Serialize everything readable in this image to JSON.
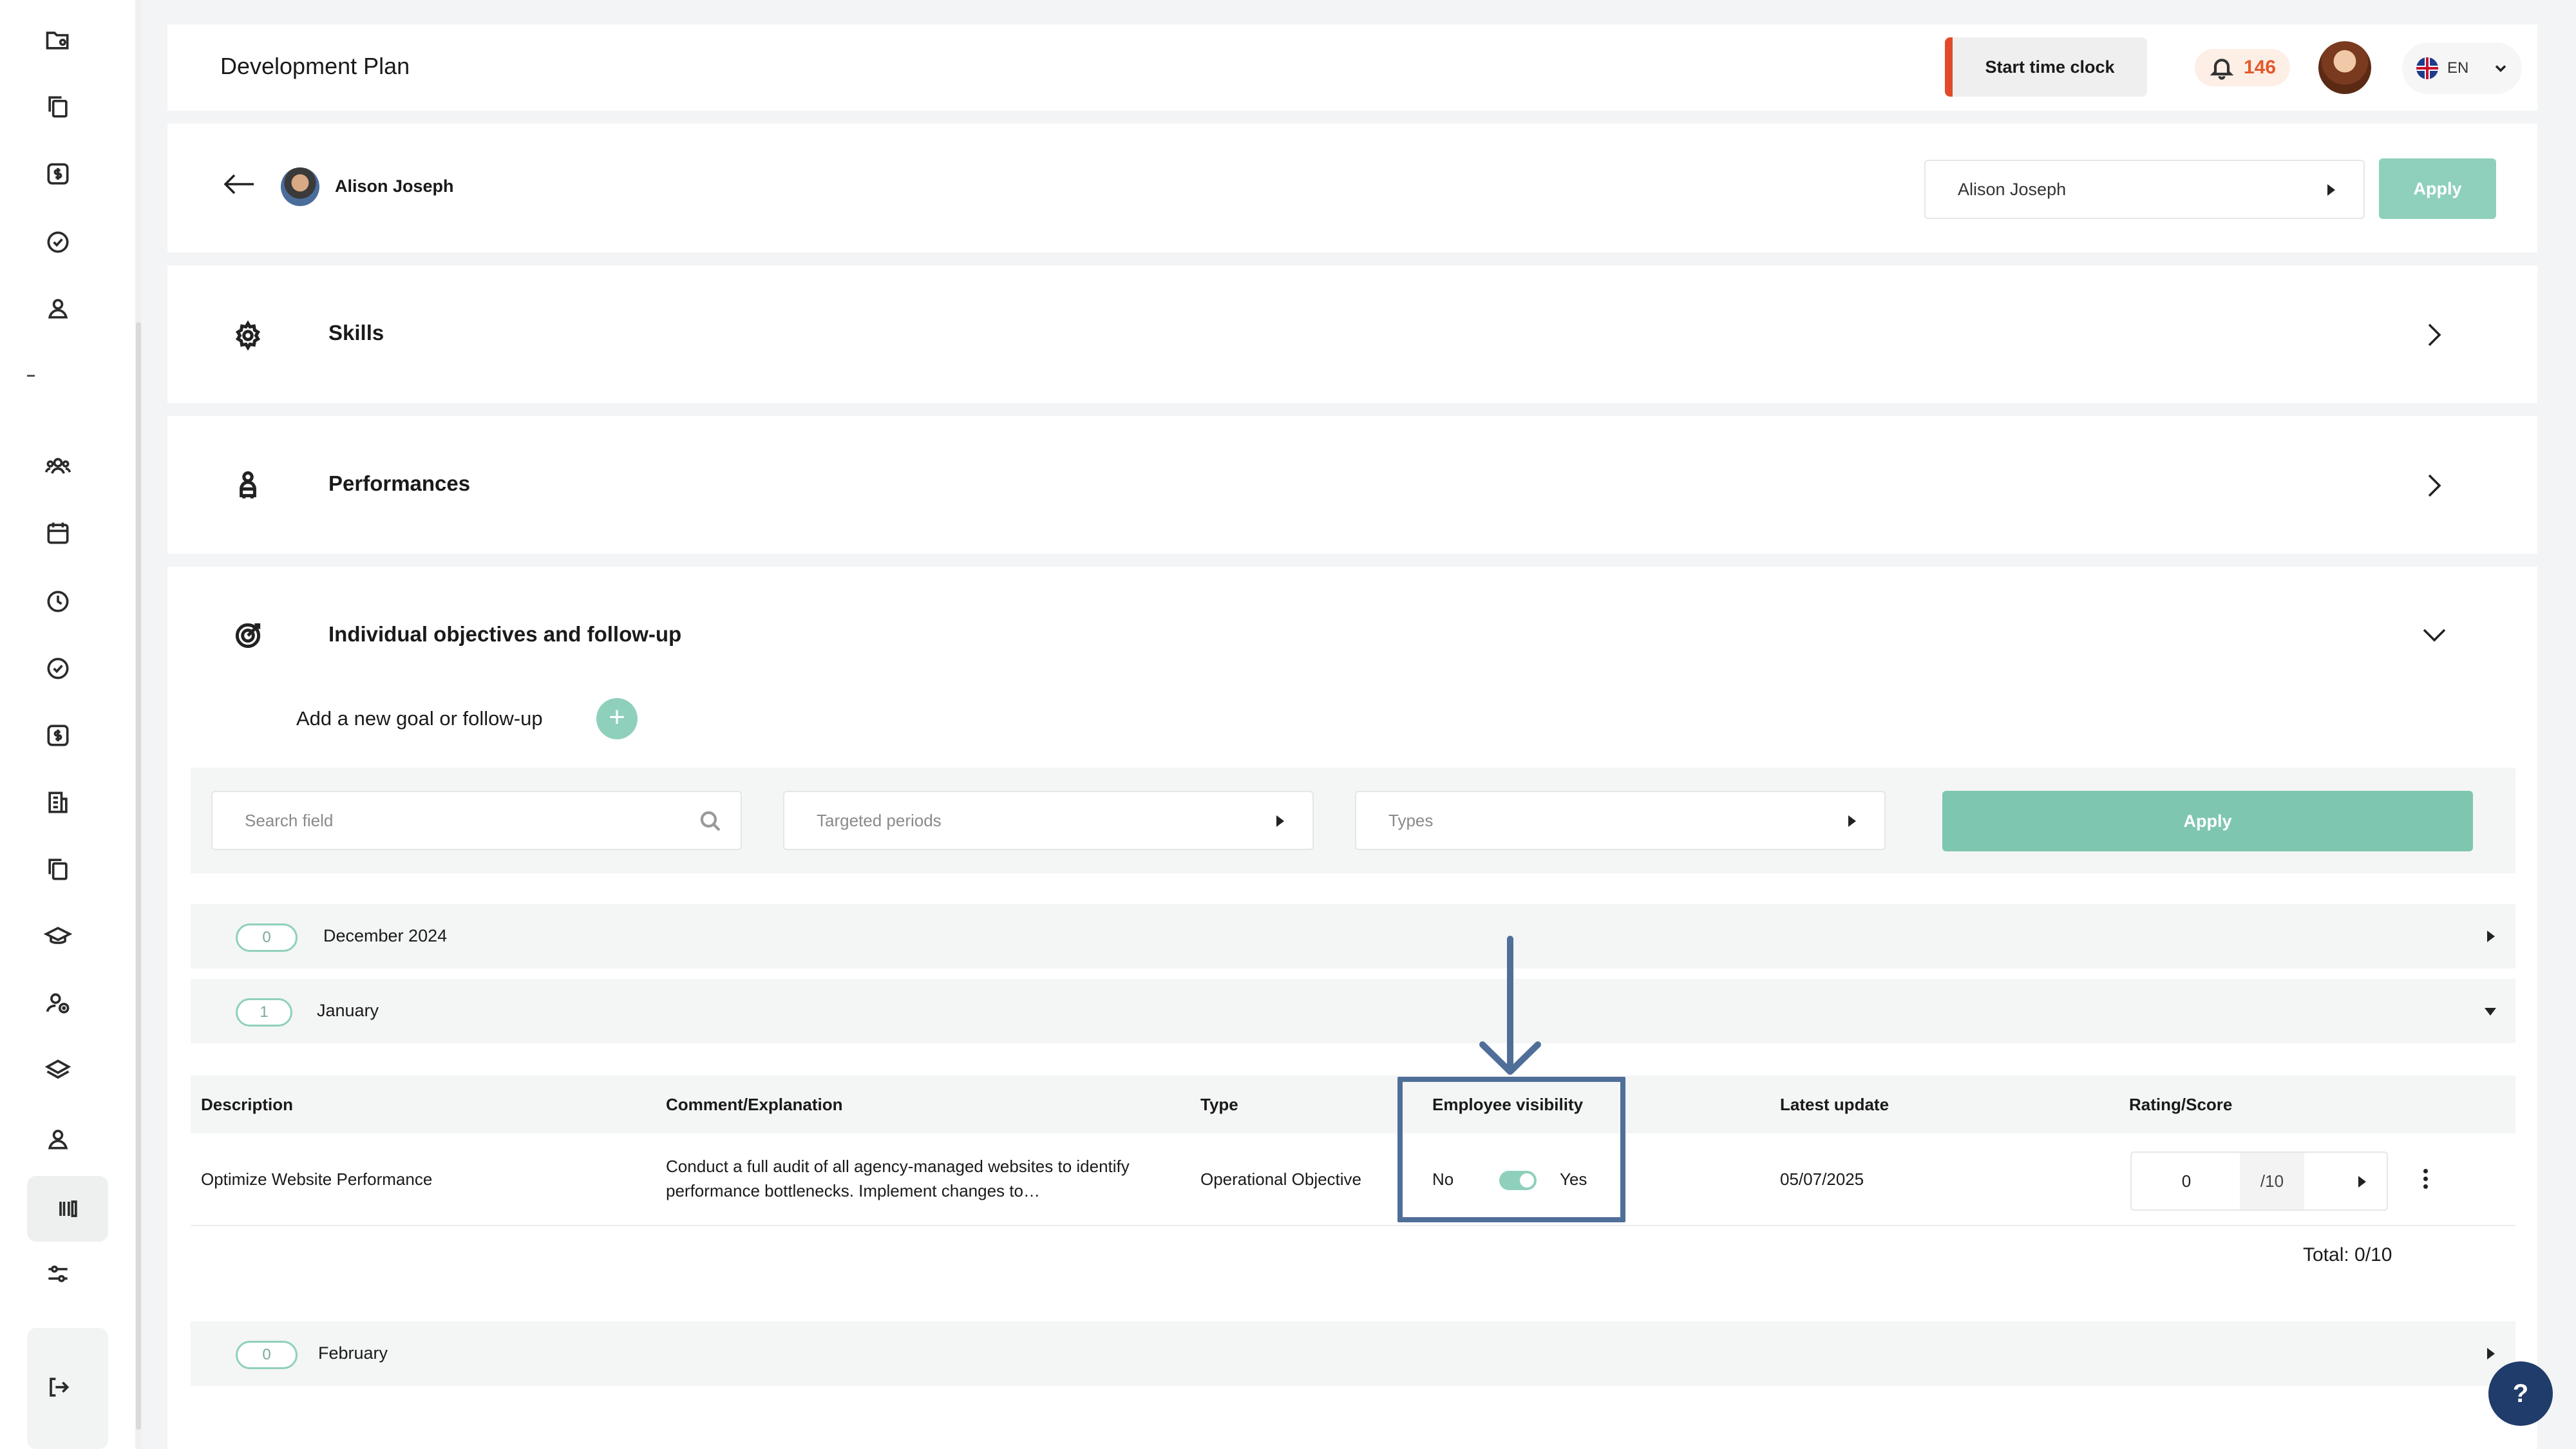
{
  "header": {
    "title": "Development Plan",
    "start_clock_label": "Start time clock",
    "notification_count": "146",
    "language": "EN"
  },
  "employee": {
    "name": "Alison Joseph",
    "select_value": "Alison  Joseph",
    "apply_label": "Apply"
  },
  "sections": {
    "skills": "Skills",
    "performances": "Performances",
    "objectives": "Individual objectives and follow-up"
  },
  "objectives": {
    "add_goal_label": "Add a new goal or follow-up",
    "add_button": "+",
    "filters": {
      "search_placeholder": "Search field",
      "periods_placeholder": "Targeted periods",
      "types_placeholder": "Types",
      "apply_label": "Apply"
    },
    "months": [
      {
        "count": "0",
        "label": "December 2024"
      },
      {
        "count": "1",
        "label": "January"
      },
      {
        "count": "0",
        "label": "February"
      }
    ],
    "columns": [
      "Description",
      "Comment/Explanation",
      "Type",
      "Employee visibility",
      "Latest update",
      "Rating/Score"
    ],
    "rows": [
      {
        "description": "Optimize Website Performance",
        "comment": "Conduct a full audit of all agency-managed websites to identify performance bottlenecks. Implement changes to…",
        "type": "Operational Objective",
        "visibility_no": "No",
        "visibility_yes": "Yes",
        "visibility_on": true,
        "latest_update": "05/07/2025",
        "score": "0",
        "score_max": "/10"
      }
    ],
    "total": "Total: 0/10"
  },
  "help_label": "?",
  "colors": {
    "accent": "#8fd0bd",
    "clock_bar": "#e14b2b",
    "notification": "#e5592b",
    "annotation": "#4f6f99",
    "help": "#1f3c6b"
  }
}
